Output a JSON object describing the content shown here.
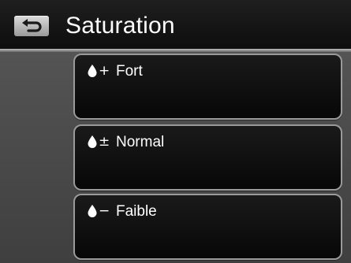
{
  "header": {
    "title": "Saturation",
    "back_icon": "back-arrow-icon"
  },
  "options": [
    {
      "icon": "droplet-icon",
      "symbol": "+",
      "label": "Fort"
    },
    {
      "icon": "droplet-icon",
      "symbol": "±",
      "label": "Normal"
    },
    {
      "icon": "droplet-icon",
      "symbol": "−",
      "label": "Faible"
    }
  ],
  "colors": {
    "header_bg": "#151515",
    "body_bg": "#4a4a4a",
    "option_bg": "#0f0f0f",
    "option_border": "#9a9a9a",
    "text": "#ffffff"
  }
}
